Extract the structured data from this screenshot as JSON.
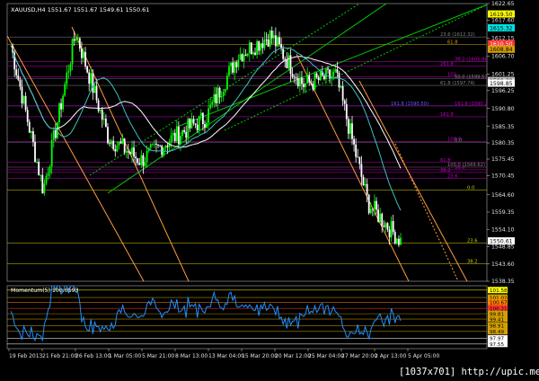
{
  "main_panel": {
    "title": "XAUUSD,H4  1551.67 1551.67 1549.61 1550.61",
    "price_ticks": [
      {
        "v": 1622.65,
        "label": "1622.65"
      },
      {
        "v": 1617.6,
        "label": "1617.60"
      },
      {
        "v": 1612.15,
        "label": "1612.15"
      },
      {
        "v": 1606.7,
        "label": "1606.70"
      },
      {
        "v": 1601.25,
        "label": "1601.25"
      },
      {
        "v": 1596.25,
        "label": "1596.25"
      },
      {
        "v": 1590.8,
        "label": "1590.80"
      },
      {
        "v": 1585.35,
        "label": "1585.35"
      },
      {
        "v": 1580.35,
        "label": "1580.35"
      },
      {
        "v": 1575.45,
        "label": "1575.45"
      },
      {
        "v": 1570.45,
        "label": "1570.45"
      },
      {
        "v": 1564.6,
        "label": "1564.60"
      },
      {
        "v": 1559.35,
        "label": "1559.35"
      },
      {
        "v": 1554.1,
        "label": "1554.10"
      },
      {
        "v": 1548.85,
        "label": "1548.85"
      },
      {
        "v": 1543.6,
        "label": "1543.60"
      },
      {
        "v": 1538.35,
        "label": "1538.35"
      }
    ],
    "price_badges": [
      {
        "v": 1619.5,
        "label": "1619.50",
        "color": "#ffff00",
        "text": "#000000"
      },
      {
        "v": 1615.3,
        "label": "1615.32",
        "color": "#00e0e0",
        "text": "#000000"
      },
      {
        "v": 1610.5,
        "label": "1610.50",
        "color": "#ff3030",
        "text": "#ffffff"
      },
      {
        "v": 1608.8,
        "label": "1608.84",
        "color": "#d4a000",
        "text": "#000000"
      },
      {
        "v": 1599.3,
        "label": "1599.32",
        "color": "#c0c0c0",
        "text": "#000000"
      },
      {
        "v": 1598.5,
        "label": "1598.85",
        "color": "#ffffff",
        "text": "#000000"
      },
      {
        "v": 1550.6,
        "label": "1550.61",
        "color": "#ffffff",
        "text": "#000000"
      }
    ],
    "fib_levels": [
      {
        "v": 1612.5,
        "label": "23.6 (1612.32)",
        "color": "#808080"
      },
      {
        "v": 1610.3,
        "label": "61.8",
        "color": "#d4a000"
      },
      {
        "v": 1605.1,
        "label": "38.2 (1605.98)",
        "color": "#c000c0"
      },
      {
        "v": 1603.6,
        "label": "261.8",
        "color": "#c000c0"
      },
      {
        "v": 1600.4,
        "label": "100",
        "color": "#c000c0"
      },
      {
        "v": 1599.8,
        "label": "50.0 (1599.57)",
        "color": "#808080"
      },
      {
        "v": 1597.8,
        "label": "61.8 (1597.74)",
        "color": "#808080"
      },
      {
        "v": 1591.6,
        "label": "161.8 (1590.50)",
        "color": "#6060ff"
      },
      {
        "v": 1591.6,
        "label": "161.8 (1590.223)",
        "color": "#c000c0"
      },
      {
        "v": 1588.3,
        "label": "161.8",
        "color": "#c000c0"
      },
      {
        "v": 1580.8,
        "label": "100.0",
        "color": "#c000c0"
      },
      {
        "v": 1580.5,
        "label": "0.0",
        "color": "#808080"
      },
      {
        "v": 1574.4,
        "label": "61.8",
        "color": "#c000c0"
      },
      {
        "v": 1573.0,
        "label": "100.0 (1569.62)",
        "color": "#808080"
      },
      {
        "v": 1572.2,
        "label": "50.0",
        "color": "#c000c0"
      },
      {
        "v": 1571.4,
        "label": "38.2",
        "color": "#c000c0"
      },
      {
        "v": 1569.6,
        "label": "23.6",
        "color": "#c000c0"
      },
      {
        "v": 1566.1,
        "label": "0.0",
        "color": "#c8c800"
      },
      {
        "v": 1550.0,
        "label": "23.6",
        "color": "#c8c800"
      },
      {
        "v": 1543.7,
        "label": "38.2",
        "color": "#c8c800"
      }
    ]
  },
  "momentum_panel": {
    "title": "Momentum(5) 100.0593",
    "levels": [
      {
        "v": 101.58,
        "label": "101.58",
        "color": "#ffff00",
        "text": "#000000"
      },
      {
        "v": 101.02,
        "label": "101.02",
        "color": "#d4a000",
        "text": "#000000"
      },
      {
        "v": 100.67,
        "label": "100.67",
        "color": "#ff8000",
        "text": "#000000"
      },
      {
        "v": 100.21,
        "label": "100.21",
        "color": "#ff3030",
        "text": "#000000"
      },
      {
        "v": 99.81,
        "label": "99.81",
        "color": "#d4a000",
        "text": "#000000"
      },
      {
        "v": 99.41,
        "label": "99.41",
        "color": "#d4a000",
        "text": "#000000"
      },
      {
        "v": 98.91,
        "label": "98.91",
        "color": "#d4a000",
        "text": "#000000"
      },
      {
        "v": 98.49,
        "label": "98.49",
        "color": "#d4a000",
        "text": "#000000"
      },
      {
        "v": 97.97,
        "label": "97.97",
        "color": "#ffffff",
        "text": "#000000"
      },
      {
        "v": 97.55,
        "label": "97.55",
        "color": "#ffffff",
        "text": "#000000"
      }
    ]
  },
  "time_axis": [
    "19 Feb 2013",
    "21 Feb 21:00",
    "26 Feb 13:00",
    "1 Mar 05:00",
    "5 Mar 21:00",
    "8 Mar 13:00",
    "13 Mar 04:00",
    "15 Mar 20:00",
    "20 Mar 12:00",
    "25 Mar 04:00",
    "27 Mar 20:00",
    "2 Apr 13:00",
    "5 Apr 05:00"
  ],
  "watermark": "[1037x701] http://upic.me/",
  "colors": {
    "background": "#000000",
    "bull": "#00ff00",
    "bear": "#ffffff",
    "momentum_line": "#1e90ff",
    "ma_white": "#ffffff",
    "ma_cyan": "#40c0c0",
    "channel_orange": "#ff9c40",
    "channel_green": "#00c800"
  },
  "chart_data": {
    "type": "line",
    "title": "XAUUSD,H4  1551.67 1551.67 1549.61 1550.61",
    "x": [
      "19 Feb 2013",
      "21 Feb 21:00",
      "26 Feb 13:00",
      "1 Mar 05:00",
      "5 Mar 21:00",
      "8 Mar 13:00",
      "13 Mar 04:00",
      "15 Mar 20:00",
      "20 Mar 12:00",
      "25 Mar 04:00",
      "27 Mar 20:00",
      "2 Apr 13:00",
      "5 Apr 05:00"
    ],
    "series": [
      {
        "values": [
          1610,
          1566,
          1614,
          1582,
          1575,
          1582,
          1588,
          1607,
          1613,
          1598,
          1601,
          1562,
          1550.61
        ]
      }
    ],
    "ylim": [
      1538.35,
      1622.65
    ],
    "grid": false
  }
}
